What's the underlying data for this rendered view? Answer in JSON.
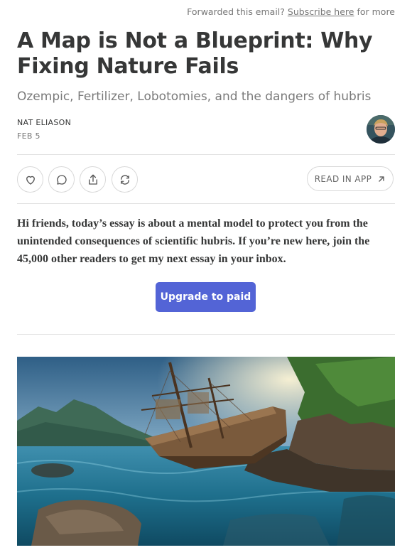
{
  "forward": {
    "prefix": "Forwarded this email?",
    "link": "Subscribe here",
    "suffix": "for more"
  },
  "post": {
    "title": "A Map is Not a Blueprint: Why Fixing Nature Fails",
    "subtitle": "Ozempic, Fertilizer, Lobotomies, and the dangers of hubris",
    "author": "NAT ELIASON",
    "date": "FEB 5"
  },
  "actions": {
    "icons": [
      "heart-icon",
      "comment-icon",
      "share-icon",
      "restack-icon"
    ],
    "read_in_app": "READ IN APP"
  },
  "intro": "Hi friends, today’s essay is about a mental model to protect you from the unintended consequences of scientific hubris. If you’re new here, join the 45,000 other readers to get my next essay in your inbox.",
  "cta": {
    "upgrade_label": "Upgrade to paid"
  },
  "colors": {
    "accent": "#5364d6",
    "text": "#363737",
    "muted": "#777777"
  }
}
